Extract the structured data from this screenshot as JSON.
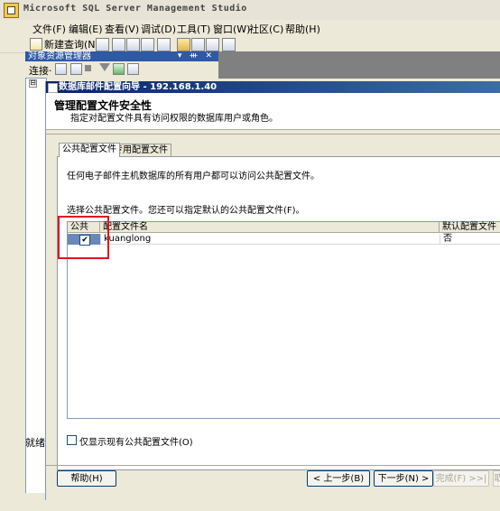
{
  "window": {
    "title": "Microsoft SQL Server Management Studio"
  },
  "menu": [
    "文件(F)",
    "编辑(E)",
    "查看(V)",
    "调试(D)",
    "工具(T)",
    "窗口(W)",
    "社区(C)",
    "帮助(H)"
  ],
  "toolbar": {
    "new_query": "新建查询(N)"
  },
  "object_explorer": {
    "title": "对象资源管理器",
    "controls": "▾ ᚒ ✕",
    "connect": "连接·",
    "status": "就绪",
    "expander": "⊟"
  },
  "wizard": {
    "title": "数据库邮件配置向导 - 192.168.1.40",
    "heading": "管理配置文件安全性",
    "subheading": "指定对配置文件具有访问权限的数据库用户或角色。",
    "tabs": [
      "公共配置文件",
      "专用配置文件"
    ],
    "desc1": "任何电子邮件主机数据库的所有用户都可以访问公共配置文件。",
    "desc2": "选择公共配置文件。您还可以指定默认的公共配置文件(F)。",
    "grid": {
      "columns": [
        "公共",
        "配置文件名",
        "默认配置文件"
      ],
      "rows": [
        {
          "public": "✔",
          "name": "kuanglong",
          "default": "否"
        }
      ]
    },
    "show_existing_label": "仅显示现有公共配置文件(O)",
    "buttons": {
      "help": "帮助(H)",
      "back": "< 上一步(B)",
      "next": "下一步(N) >",
      "finish": "完成(F) >>|",
      "cancel": "取"
    }
  }
}
